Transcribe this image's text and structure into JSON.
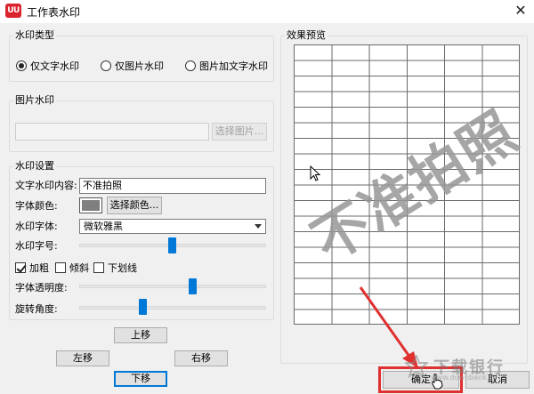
{
  "window": {
    "app_icon_text": "UU",
    "title": "工作表水印"
  },
  "watermark_type": {
    "label": "水印类型",
    "options": [
      {
        "label": "仅文字水印",
        "checked": true
      },
      {
        "label": "仅图片水印",
        "checked": false
      },
      {
        "label": "图片加文字水印",
        "checked": false
      }
    ]
  },
  "image_watermark": {
    "label": "图片水印",
    "path_value": "",
    "select_button": "选择图片..."
  },
  "settings": {
    "label": "水印设置",
    "content_label": "文字水印内容:",
    "content_value": "不准拍照",
    "color_label": "字体颜色:",
    "color_swatch": "#7f7f7f",
    "color_button": "选择颜色...",
    "font_label": "水印字体:",
    "font_value": "微软雅黑",
    "size_label": "水印字号:",
    "size_level": 0.5,
    "bold_label": "加粗",
    "bold_checked": true,
    "italic_label": "倾斜",
    "italic_checked": false,
    "underline_label": "下划线",
    "underline_checked": false,
    "opacity_label": "字体透明度:",
    "opacity_level": 0.6,
    "rotation_label": "旋转角度:",
    "rotation_level": 0.34
  },
  "move": {
    "up": "上移",
    "left": "左移",
    "right": "右移",
    "down": "下移"
  },
  "preview": {
    "label": "效果预览",
    "watermark_text": "不准拍照"
  },
  "buttons": {
    "ok": "确定",
    "cancel": "取消"
  },
  "overlay": {
    "site_logo_text": "下载银行",
    "site_url": "www.downbank.cn"
  },
  "colors": {
    "accent": "#0078d7",
    "annotation_red": "#e03030"
  }
}
